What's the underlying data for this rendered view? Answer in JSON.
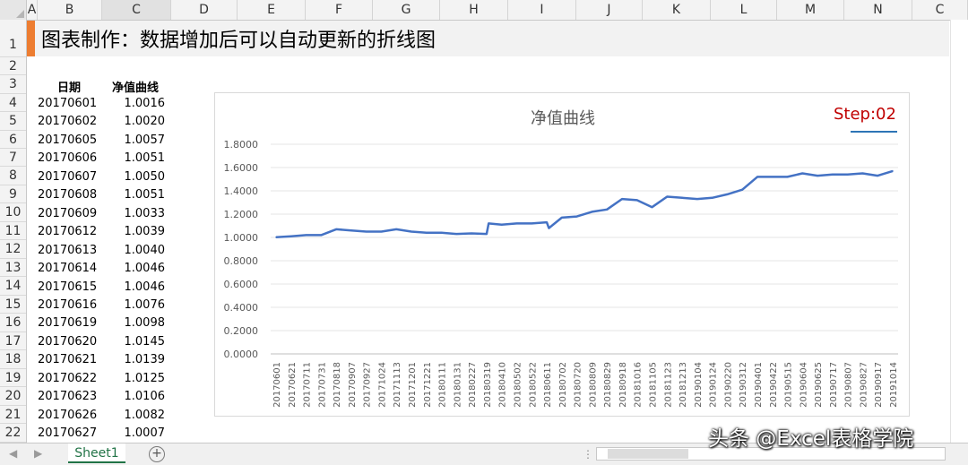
{
  "columns": [
    "A",
    "B",
    "C",
    "D",
    "E",
    "F",
    "G",
    "H",
    "I",
    "J",
    "K",
    "L",
    "M",
    "N",
    "C"
  ],
  "selected_column": "C",
  "rows": [
    "1",
    "2",
    "3",
    "4",
    "5",
    "6",
    "7",
    "8",
    "9",
    "10",
    "11",
    "12",
    "13",
    "14",
    "15",
    "16",
    "17",
    "18",
    "19",
    "20",
    "21",
    "22"
  ],
  "title": "图表制作：数据增加后可以自动更新的折线图",
  "title_accent_color": "#ED7D31",
  "table": {
    "headers": [
      "日期",
      "净值曲线"
    ],
    "rows": [
      [
        "20170601",
        "1.0016"
      ],
      [
        "20170602",
        "1.0020"
      ],
      [
        "20170605",
        "1.0057"
      ],
      [
        "20170606",
        "1.0051"
      ],
      [
        "20170607",
        "1.0050"
      ],
      [
        "20170608",
        "1.0051"
      ],
      [
        "20170609",
        "1.0033"
      ],
      [
        "20170612",
        "1.0039"
      ],
      [
        "20170613",
        "1.0040"
      ],
      [
        "20170614",
        "1.0046"
      ],
      [
        "20170615",
        "1.0046"
      ],
      [
        "20170616",
        "1.0076"
      ],
      [
        "20170619",
        "1.0098"
      ],
      [
        "20170620",
        "1.0145"
      ],
      [
        "20170621",
        "1.0139"
      ],
      [
        "20170622",
        "1.0125"
      ],
      [
        "20170623",
        "1.0106"
      ],
      [
        "20170626",
        "1.0082"
      ],
      [
        "20170627",
        "1.0007"
      ]
    ]
  },
  "chart_data": {
    "type": "line",
    "title": "净值曲线",
    "annotation": "Step:02",
    "line_color": "#4472C4",
    "annotation_color": "#C00000",
    "y_ticks": [
      "0.0000",
      "0.2000",
      "0.4000",
      "0.6000",
      "0.8000",
      "1.0000",
      "1.2000",
      "1.4000",
      "1.6000",
      "1.8000"
    ],
    "ylim": [
      0,
      1.8
    ],
    "grid": true,
    "x_tick_labels": [
      "20170601",
      "20170621",
      "20170711",
      "20170731",
      "20170818",
      "20170907",
      "20170927",
      "20171024",
      "20171113",
      "20171201",
      "20171221",
      "20180111",
      "20180131",
      "20180227",
      "20180319",
      "20180410",
      "20180502",
      "20180522",
      "20180611",
      "20180702",
      "20180720",
      "20180809",
      "20180829",
      "20180918",
      "20181016",
      "20181105",
      "20181123",
      "20181213",
      "20190104",
      "20190124",
      "20190220",
      "20190312",
      "20190401",
      "20190422",
      "20190515",
      "20190604",
      "20190625",
      "20190717",
      "20190807",
      "20190827",
      "20190917",
      "20191014"
    ],
    "x": [
      "20170601",
      "20170621",
      "20170711",
      "20170731",
      "20170818",
      "20170907",
      "20170927",
      "20171024",
      "20171113",
      "20171201",
      "20171221",
      "20180111",
      "20180131",
      "20180227",
      "20180319",
      "20180322",
      "20180410",
      "20180502",
      "20180522",
      "20180611",
      "20180614",
      "20180702",
      "20180720",
      "20180809",
      "20180829",
      "20180918",
      "20181016",
      "20181105",
      "20181123",
      "20181213",
      "20190104",
      "20190124",
      "20190220",
      "20190312",
      "20190401",
      "20190422",
      "20190515",
      "20190604",
      "20190625",
      "20190717",
      "20190807",
      "20190827",
      "20190917",
      "20191014"
    ],
    "values": [
      1.0016,
      1.01,
      1.02,
      1.02,
      1.07,
      1.06,
      1.05,
      1.05,
      1.07,
      1.05,
      1.04,
      1.04,
      1.03,
      1.035,
      1.03,
      1.12,
      1.11,
      1.12,
      1.12,
      1.13,
      1.08,
      1.17,
      1.18,
      1.22,
      1.24,
      1.33,
      1.32,
      1.26,
      1.35,
      1.34,
      1.33,
      1.34,
      1.37,
      1.41,
      1.52,
      1.52,
      1.52,
      1.55,
      1.53,
      1.54,
      1.54,
      1.55,
      1.53,
      1.57
    ]
  },
  "sheet_tab": "Sheet1",
  "watermark": "头条 @Excel表格学院",
  "icons": {
    "add_sheet": "plus-circle-icon",
    "nav_prev": "triangle-left-icon",
    "nav_next": "triangle-right-icon"
  }
}
